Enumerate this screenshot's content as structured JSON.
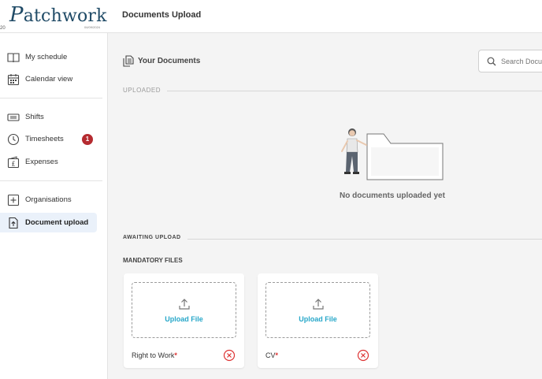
{
  "header": {
    "logo_text": "atchwork",
    "logo_initial": "P",
    "logo_sub": "04/09/2024",
    "logo_left": "20",
    "page_title": "Documents Upload"
  },
  "sidebar": {
    "items": [
      {
        "label": "My schedule",
        "icon": "book-icon"
      },
      {
        "label": "Calendar view",
        "icon": "calendar-icon"
      },
      {
        "label": "Shifts",
        "icon": "ticket-icon"
      },
      {
        "label": "Timesheets",
        "icon": "clock-icon",
        "badge": "1"
      },
      {
        "label": "Expenses",
        "icon": "pound-wallet-icon"
      },
      {
        "label": "Organisations",
        "icon": "plus-square-icon"
      },
      {
        "label": "Document upload",
        "icon": "file-upload-icon",
        "active": true
      }
    ]
  },
  "main": {
    "section_title": "Your Documents",
    "search_placeholder": "Search Documents",
    "uploaded_label": "UPLOADED",
    "empty_text": "No documents uploaded yet",
    "awaiting_label": "AWAITING UPLOAD",
    "mandatory_title": "MANDATORY FILES",
    "files": [
      {
        "name": "Right to Work",
        "required_mark": "*",
        "upload_label": "Upload File"
      },
      {
        "name": "CV",
        "required_mark": "*",
        "upload_label": "Upload File"
      }
    ]
  },
  "colors": {
    "brand": "#1f4a66",
    "accent": "#27a7c9",
    "badge": "#b52b30",
    "active_bg": "#eaf1fa",
    "danger": "#d33"
  }
}
